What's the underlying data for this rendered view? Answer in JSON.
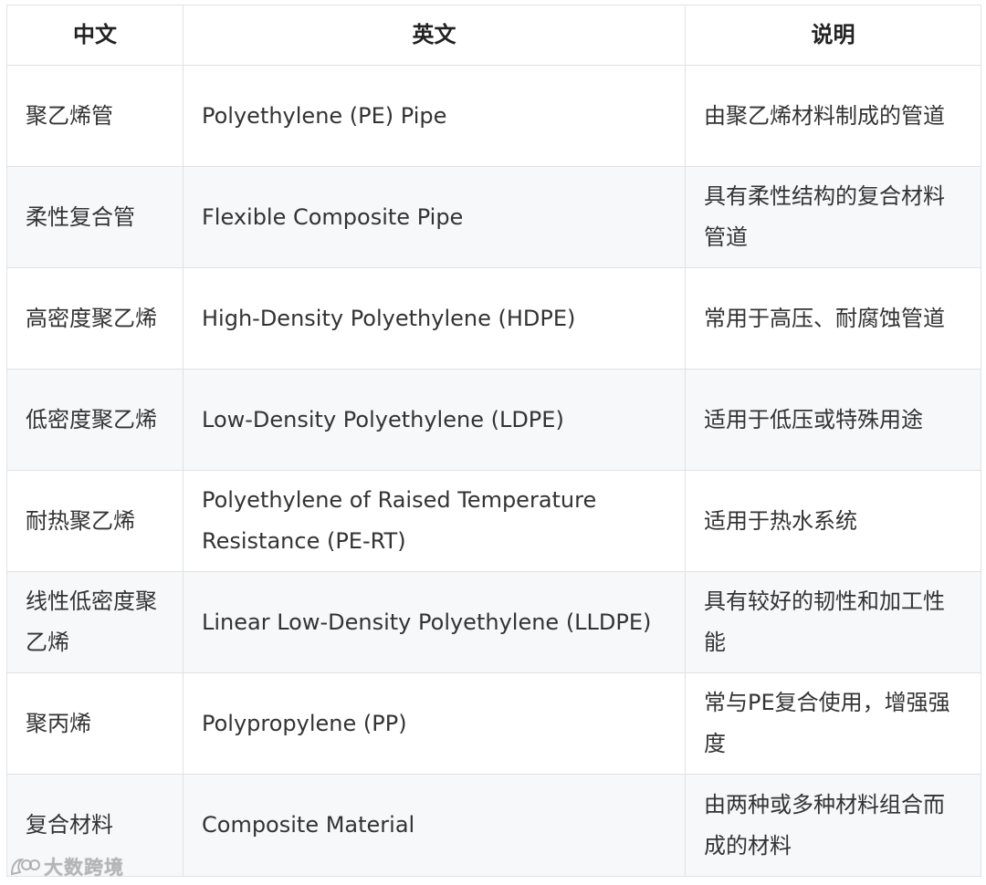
{
  "table": {
    "headers": [
      "中文",
      "英文",
      "说明"
    ],
    "rows": [
      {
        "zh": "聚乙烯管",
        "en": "Polyethylene (PE) Pipe",
        "desc": "由聚乙烯材料制成的管道"
      },
      {
        "zh": "柔性复合管",
        "en": "Flexible Composite Pipe",
        "desc": "具有柔性结构的复合材料管道"
      },
      {
        "zh": "高密度聚乙烯",
        "en": "High-Density Polyethylene (HDPE)",
        "desc": "常用于高压、耐腐蚀管道"
      },
      {
        "zh": "低密度聚乙烯",
        "en": "Low-Density Polyethylene (LDPE)",
        "desc": "适用于低压或特殊用途"
      },
      {
        "zh": "耐热聚乙烯",
        "en": "Polyethylene of Raised Temperature Resistance (PE-RT)",
        "desc": "适用于热水系统"
      },
      {
        "zh": "线性低密度聚乙烯",
        "en": "Linear Low-Density Polyethylene (LLDPE)",
        "desc": "具有较好的韧性和加工性能"
      },
      {
        "zh": "聚丙烯",
        "en": "Polypropylene (PP)",
        "desc": "常与PE复合使用，增强强度"
      },
      {
        "zh": "复合材料",
        "en": "Composite Material",
        "desc": "由两种或多种材料组合而成的材料"
      }
    ]
  },
  "watermark": {
    "text": "大数跨境",
    "icon": "brand-logo-icon"
  },
  "colors": {
    "border": "#dfe2e5",
    "zebra": "#f6f8fa",
    "text": "#333333"
  }
}
